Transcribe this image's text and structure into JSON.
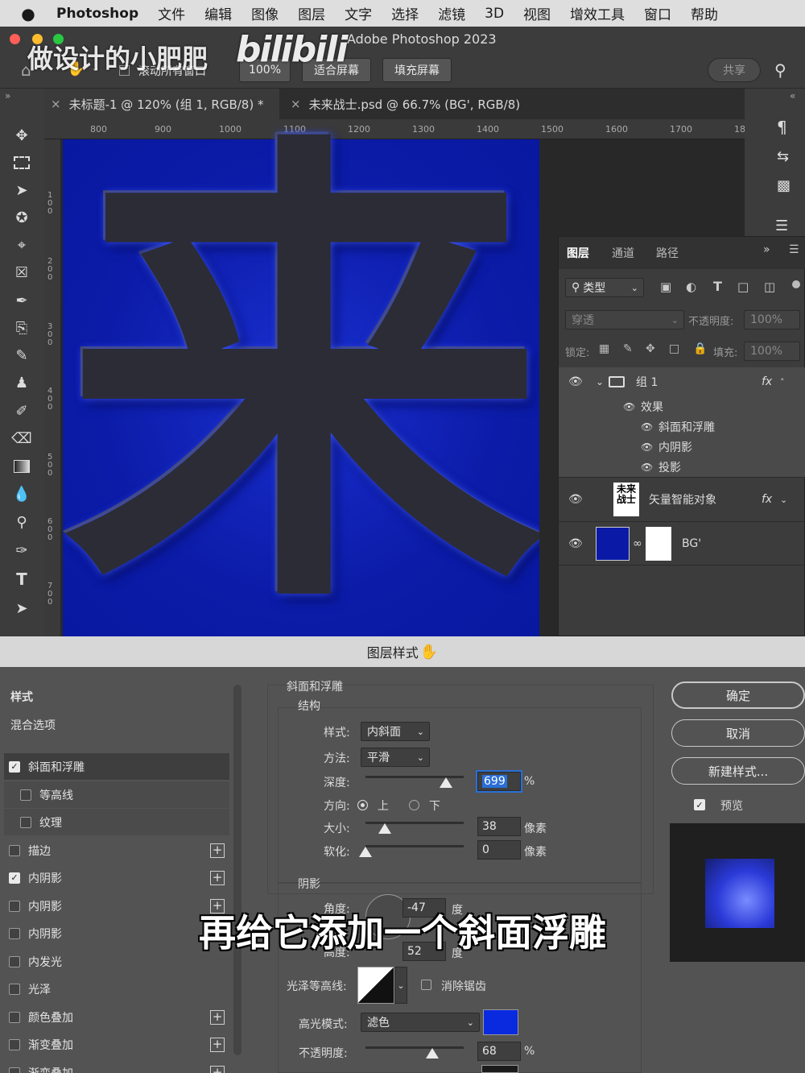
{
  "menubar": {
    "apple_icon": "",
    "app": "Photoshop",
    "items": [
      "文件",
      "编辑",
      "图像",
      "图层",
      "文字",
      "选择",
      "滤镜",
      "3D",
      "视图",
      "增效工具",
      "窗口",
      "帮助"
    ]
  },
  "window": {
    "title": "Adobe Photoshop 2023"
  },
  "watermark": {
    "channel": "做设计的小肥肥",
    "site": "bilibili"
  },
  "options_bar": {
    "scroll_all": "滚动所有窗口",
    "zoom": "100%",
    "fit_screen": "适合屏幕",
    "fill_screen": "填充屏幕",
    "share": "共享"
  },
  "tabs": [
    {
      "label": "未标题-1 @ 120% (组 1, RGB/8) *"
    },
    {
      "label": "未来战士.psd @ 66.7% (BG', RGB/8)"
    }
  ],
  "ruler": {
    "h_ticks": [
      "800",
      "900",
      "1000",
      "1100",
      "1200",
      "1300",
      "1400",
      "1500",
      "1600",
      "1700",
      "18"
    ],
    "v_ticks": [
      "100",
      "200",
      "300",
      "400",
      "500",
      "600",
      "700"
    ]
  },
  "canvas": {
    "glyph": "来",
    "bg_color": "#0a1aa6"
  },
  "layers_panel": {
    "tabs": [
      "图层",
      "通道",
      "路径"
    ],
    "filter": "类型",
    "blend_mode": "穿透",
    "opacity_label": "不透明度:",
    "opacity": "100%",
    "lock_label": "锁定:",
    "fill_label": "填充:",
    "fill": "100%",
    "fx": "fx",
    "group": {
      "name": "组 1",
      "effects_label": "效果",
      "effects": [
        "斜面和浮雕",
        "内阴影",
        "投影"
      ]
    },
    "smart_object": {
      "name": "矢量智能对象",
      "thumb_text": "未来战士"
    },
    "bg_layer": {
      "name": "BG'"
    }
  },
  "dialog": {
    "title": "图层样式",
    "styles_header": "样式",
    "blend_options": "混合选项",
    "styles": [
      {
        "label": "斜面和浮雕",
        "checked": true,
        "plus": false,
        "indent": false
      },
      {
        "label": "等高线",
        "checked": false,
        "plus": false,
        "indent": true
      },
      {
        "label": "纹理",
        "checked": false,
        "plus": false,
        "indent": true
      },
      {
        "label": "描边",
        "checked": false,
        "plus": true,
        "indent": false
      },
      {
        "label": "内阴影",
        "checked": true,
        "plus": true,
        "indent": false
      },
      {
        "label": "内阴影",
        "checked": false,
        "plus": true,
        "indent": false
      },
      {
        "label": "内阴影",
        "checked": false,
        "plus": false,
        "indent": false
      },
      {
        "label": "内发光",
        "checked": false,
        "plus": false,
        "indent": false
      },
      {
        "label": "光泽",
        "checked": false,
        "plus": false,
        "indent": false
      },
      {
        "label": "颜色叠加",
        "checked": false,
        "plus": true,
        "indent": false
      },
      {
        "label": "渐变叠加",
        "checked": false,
        "plus": true,
        "indent": false
      },
      {
        "label": "渐变叠加",
        "checked": false,
        "plus": true,
        "indent": false
      }
    ],
    "bevel": {
      "section": "斜面和浮雕",
      "structure": "结构",
      "style_label": "样式:",
      "style_value": "内斜面",
      "method_label": "方法:",
      "method_value": "平滑",
      "depth_label": "深度:",
      "depth_value": "699",
      "depth_unit": "%",
      "depth_slider": 0.82,
      "direction_label": "方向:",
      "dir_up": "上",
      "dir_down": "下",
      "size_label": "大小:",
      "size_value": "38",
      "size_unit": "像素",
      "size_slider": 0.2,
      "soften_label": "软化:",
      "soften_value": "0",
      "soften_unit": "像素",
      "soften_slider": 0.0
    },
    "shading": {
      "section": "阴影",
      "angle_label": "角度:",
      "angle_value": "-47",
      "angle_unit": "度",
      "altitude_label": "高度:",
      "altitude_value": "52",
      "altitude_unit": "度",
      "gloss_label": "光泽等高线:",
      "antialias": "消除锯齿",
      "highlight_label": "高光模式:",
      "highlight_mode": "滤色",
      "highlight_color": "#0a2ae0",
      "opacity_label": "不透明度:",
      "opacity_value": "68",
      "opacity_unit": "%",
      "opacity_slider": 0.68
    },
    "buttons": {
      "ok": "确定",
      "cancel": "取消",
      "new_style": "新建样式...",
      "preview": "预览"
    }
  },
  "subtitle": "再给它添加一个斜面浮雕"
}
